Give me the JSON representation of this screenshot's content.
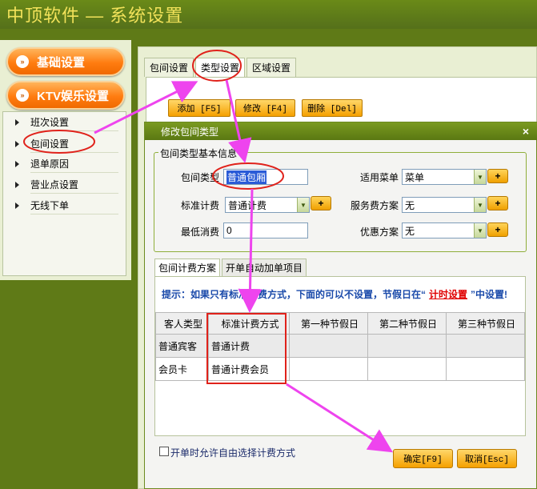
{
  "app": {
    "title": "中顶软件 — 系统设置"
  },
  "sidebar": {
    "groups": [
      {
        "label": "基础设置"
      },
      {
        "label": "KTV娱乐设置"
      }
    ],
    "items": [
      {
        "label": "班次设置"
      },
      {
        "label": "包间设置"
      },
      {
        "label": "退单原因"
      },
      {
        "label": "营业点设置"
      },
      {
        "label": "无线下单"
      }
    ]
  },
  "main": {
    "tabs": [
      {
        "label": "包间设置"
      },
      {
        "label": "类型设置"
      },
      {
        "label": "区域设置"
      }
    ],
    "toolbar": {
      "add": "添加 [F5]",
      "edit": "修改 [F4]",
      "delete": "删除 [Del]"
    }
  },
  "dialog": {
    "title": "修改包间类型",
    "close": "×",
    "section_title": "包间类型基本信息",
    "fields": {
      "room_type": {
        "label": "包间类型",
        "value": "普通包厢"
      },
      "menu": {
        "label": "适用菜单",
        "value": "菜单"
      },
      "billing": {
        "label": "标准计费",
        "value": "普通计费"
      },
      "service_fee": {
        "label": "服务费方案",
        "value": "无"
      },
      "min_spend": {
        "label": "最低消费",
        "value": "0"
      },
      "discount": {
        "label": "优惠方案",
        "value": "无"
      }
    },
    "plus": "+",
    "inner_tabs": [
      {
        "label": "包间计费方案"
      },
      {
        "label": "开单自动加单项目"
      }
    ],
    "hint": {
      "before": "提示：如果只有标准计费方式，下面的可以不设置，节假日在“",
      "link": "计时设置",
      "after": "”中设置!"
    },
    "table": {
      "headers": [
        "客人类型",
        "标准计费方式",
        "第一种节假日",
        "第二种节假日",
        "第三种节假日"
      ],
      "rows": [
        [
          "普通宾客",
          "普通计费",
          "",
          "",
          ""
        ],
        [
          "会员卡",
          "普通计费会员",
          "",
          "",
          ""
        ]
      ]
    },
    "checkbox_label": "开单时允许自由选择计费方式",
    "ok": "确定[F9]",
    "cancel": "取消[Esc]"
  },
  "colors": {
    "annotation_arrow": "#ee44ee",
    "annotation_box": "#e0221b",
    "accent_orange": "#ff7c10",
    "hint_blue": "#1a4aaa"
  }
}
